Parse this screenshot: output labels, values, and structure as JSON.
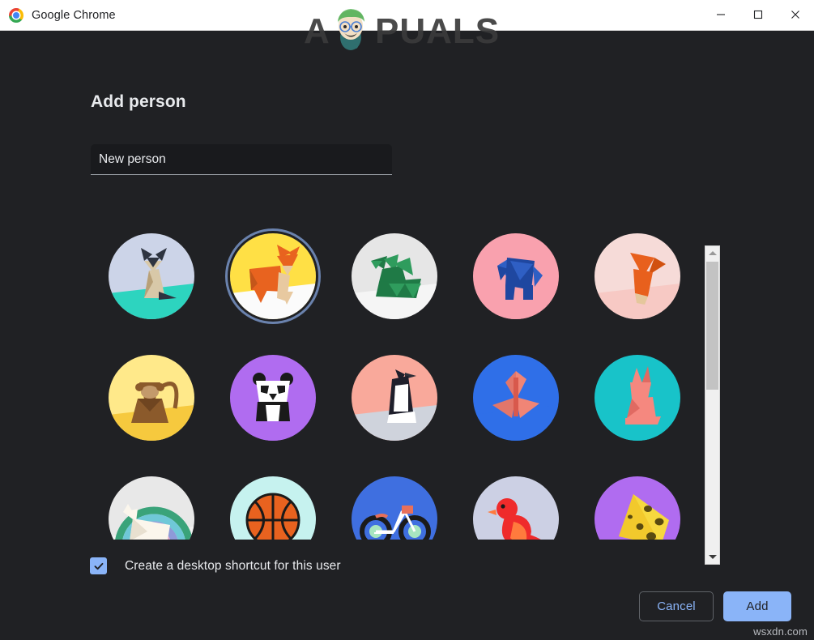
{
  "window": {
    "title": "Google Chrome",
    "logo_icon": "chrome-logo-icon",
    "controls": {
      "minimize": "minimize-icon",
      "maximize": "maximize-icon",
      "close": "close-icon"
    }
  },
  "watermarks": {
    "primary": "APPUALS",
    "secondary": "wsxdn.com"
  },
  "dialog": {
    "heading": "Add person",
    "name_input": {
      "value": "New person",
      "placeholder": "New person"
    },
    "checkbox": {
      "label": "Create a desktop shortcut for this user",
      "checked": true,
      "icon": "check-icon"
    },
    "buttons": {
      "cancel": "Cancel",
      "add": "Add"
    },
    "scrollbar": {
      "up_arrow_icon": "chevron-up-icon",
      "down_arrow_icon": "chevron-down-icon"
    }
  },
  "colors": {
    "background": "#202124",
    "titlebar": "#ffffff",
    "accent": "#8ab4f8",
    "text_primary": "#e8eaed",
    "selection_ring": "#6a82ad",
    "input_fill": "#191a1d",
    "input_underline": "#9aa0a6"
  },
  "avatars": {
    "selected_index": 1,
    "items": [
      {
        "name": "origami-cat",
        "bg": "#ccd4e8",
        "ground": "#2dd4bf",
        "subject": "#d8c8a8",
        "accent": "#2e3440"
      },
      {
        "name": "origami-fox",
        "bg": "#ffe045",
        "ground": "#fbfbfb",
        "subject": "#e8631f",
        "accent": "#e8c9a0"
      },
      {
        "name": "origami-dragon",
        "bg": "#e6e6e6",
        "ground": "#f5f5f5",
        "subject": "#1f7a46",
        "accent": "#2f9c5d"
      },
      {
        "name": "origami-elephant",
        "bg": "#f9a1ae",
        "ground": "#f9a1ae",
        "subject": "#1f47a0",
        "accent": "#2f5fc4"
      },
      {
        "name": "origami-bird-orange",
        "bg": "#f6dbd8",
        "ground": "#f7c9c4",
        "subject": "#e8601d",
        "accent": "#e5c79c"
      },
      {
        "name": "origami-monkey",
        "bg": "#ffe98a",
        "ground": "#f6c93e",
        "subject": "#8b5a2b",
        "accent": "#c39a6b"
      },
      {
        "name": "origami-panda",
        "bg": "#b06cf0",
        "ground": "#b06cf0",
        "subject": "#ffffff",
        "accent": "#1a1a1a"
      },
      {
        "name": "origami-penguin",
        "bg": "#f9a99b",
        "ground": "#cfd3dc",
        "subject": "#ffffff",
        "accent": "#1f1f2b"
      },
      {
        "name": "origami-butterfly",
        "bg": "#2f6fe8",
        "ground": "#2f6fe8",
        "subject": "#f08576",
        "accent": "#1d4fb5"
      },
      {
        "name": "origami-rabbit",
        "bg": "#18c3c9",
        "ground": "#18c3c9",
        "subject": "#f5887f",
        "accent": "#e06a62"
      },
      {
        "name": "origami-unicorn",
        "bg": "#e8e8e8",
        "ground": "#f2f2f2",
        "subject": "#fbf6ec",
        "accent": "#3aa37a"
      },
      {
        "name": "basketball",
        "bg": "#c6f2ef",
        "ground": "#c6f2ef",
        "subject": "#e8621f",
        "accent": "#1a1a1a"
      },
      {
        "name": "bicycle",
        "bg": "#3f6fe0",
        "ground": "#3f6fe0",
        "subject": "#ffffff",
        "accent": "#e8705a"
      },
      {
        "name": "red-bird",
        "bg": "#ccd0e4",
        "ground": "#ccd0e4",
        "subject": "#ef2b2b",
        "accent": "#ff7a3d"
      },
      {
        "name": "cheese",
        "bg": "#b06cf0",
        "ground": "#b06cf0",
        "subject": "#f7d83f",
        "accent": "#5a4a10"
      }
    ]
  }
}
